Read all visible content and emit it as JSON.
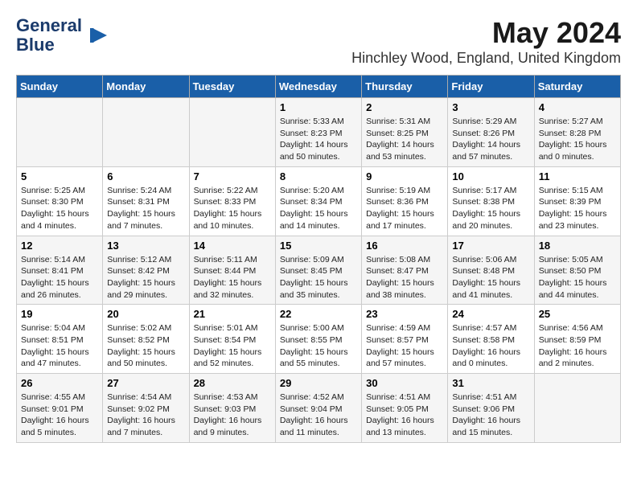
{
  "header": {
    "logo_line1": "General",
    "logo_line2": "Blue",
    "month": "May 2024",
    "location": "Hinchley Wood, England, United Kingdom"
  },
  "weekdays": [
    "Sunday",
    "Monday",
    "Tuesday",
    "Wednesday",
    "Thursday",
    "Friday",
    "Saturday"
  ],
  "weeks": [
    [
      {
        "day": "",
        "info": ""
      },
      {
        "day": "",
        "info": ""
      },
      {
        "day": "",
        "info": ""
      },
      {
        "day": "1",
        "info": "Sunrise: 5:33 AM\nSunset: 8:23 PM\nDaylight: 14 hours\nand 50 minutes."
      },
      {
        "day": "2",
        "info": "Sunrise: 5:31 AM\nSunset: 8:25 PM\nDaylight: 14 hours\nand 53 minutes."
      },
      {
        "day": "3",
        "info": "Sunrise: 5:29 AM\nSunset: 8:26 PM\nDaylight: 14 hours\nand 57 minutes."
      },
      {
        "day": "4",
        "info": "Sunrise: 5:27 AM\nSunset: 8:28 PM\nDaylight: 15 hours\nand 0 minutes."
      }
    ],
    [
      {
        "day": "5",
        "info": "Sunrise: 5:25 AM\nSunset: 8:30 PM\nDaylight: 15 hours\nand 4 minutes."
      },
      {
        "day": "6",
        "info": "Sunrise: 5:24 AM\nSunset: 8:31 PM\nDaylight: 15 hours\nand 7 minutes."
      },
      {
        "day": "7",
        "info": "Sunrise: 5:22 AM\nSunset: 8:33 PM\nDaylight: 15 hours\nand 10 minutes."
      },
      {
        "day": "8",
        "info": "Sunrise: 5:20 AM\nSunset: 8:34 PM\nDaylight: 15 hours\nand 14 minutes."
      },
      {
        "day": "9",
        "info": "Sunrise: 5:19 AM\nSunset: 8:36 PM\nDaylight: 15 hours\nand 17 minutes."
      },
      {
        "day": "10",
        "info": "Sunrise: 5:17 AM\nSunset: 8:38 PM\nDaylight: 15 hours\nand 20 minutes."
      },
      {
        "day": "11",
        "info": "Sunrise: 5:15 AM\nSunset: 8:39 PM\nDaylight: 15 hours\nand 23 minutes."
      }
    ],
    [
      {
        "day": "12",
        "info": "Sunrise: 5:14 AM\nSunset: 8:41 PM\nDaylight: 15 hours\nand 26 minutes."
      },
      {
        "day": "13",
        "info": "Sunrise: 5:12 AM\nSunset: 8:42 PM\nDaylight: 15 hours\nand 29 minutes."
      },
      {
        "day": "14",
        "info": "Sunrise: 5:11 AM\nSunset: 8:44 PM\nDaylight: 15 hours\nand 32 minutes."
      },
      {
        "day": "15",
        "info": "Sunrise: 5:09 AM\nSunset: 8:45 PM\nDaylight: 15 hours\nand 35 minutes."
      },
      {
        "day": "16",
        "info": "Sunrise: 5:08 AM\nSunset: 8:47 PM\nDaylight: 15 hours\nand 38 minutes."
      },
      {
        "day": "17",
        "info": "Sunrise: 5:06 AM\nSunset: 8:48 PM\nDaylight: 15 hours\nand 41 minutes."
      },
      {
        "day": "18",
        "info": "Sunrise: 5:05 AM\nSunset: 8:50 PM\nDaylight: 15 hours\nand 44 minutes."
      }
    ],
    [
      {
        "day": "19",
        "info": "Sunrise: 5:04 AM\nSunset: 8:51 PM\nDaylight: 15 hours\nand 47 minutes."
      },
      {
        "day": "20",
        "info": "Sunrise: 5:02 AM\nSunset: 8:52 PM\nDaylight: 15 hours\nand 50 minutes."
      },
      {
        "day": "21",
        "info": "Sunrise: 5:01 AM\nSunset: 8:54 PM\nDaylight: 15 hours\nand 52 minutes."
      },
      {
        "day": "22",
        "info": "Sunrise: 5:00 AM\nSunset: 8:55 PM\nDaylight: 15 hours\nand 55 minutes."
      },
      {
        "day": "23",
        "info": "Sunrise: 4:59 AM\nSunset: 8:57 PM\nDaylight: 15 hours\nand 57 minutes."
      },
      {
        "day": "24",
        "info": "Sunrise: 4:57 AM\nSunset: 8:58 PM\nDaylight: 16 hours\nand 0 minutes."
      },
      {
        "day": "25",
        "info": "Sunrise: 4:56 AM\nSunset: 8:59 PM\nDaylight: 16 hours\nand 2 minutes."
      }
    ],
    [
      {
        "day": "26",
        "info": "Sunrise: 4:55 AM\nSunset: 9:01 PM\nDaylight: 16 hours\nand 5 minutes."
      },
      {
        "day": "27",
        "info": "Sunrise: 4:54 AM\nSunset: 9:02 PM\nDaylight: 16 hours\nand 7 minutes."
      },
      {
        "day": "28",
        "info": "Sunrise: 4:53 AM\nSunset: 9:03 PM\nDaylight: 16 hours\nand 9 minutes."
      },
      {
        "day": "29",
        "info": "Sunrise: 4:52 AM\nSunset: 9:04 PM\nDaylight: 16 hours\nand 11 minutes."
      },
      {
        "day": "30",
        "info": "Sunrise: 4:51 AM\nSunset: 9:05 PM\nDaylight: 16 hours\nand 13 minutes."
      },
      {
        "day": "31",
        "info": "Sunrise: 4:51 AM\nSunset: 9:06 PM\nDaylight: 16 hours\nand 15 minutes."
      },
      {
        "day": "",
        "info": ""
      }
    ]
  ]
}
